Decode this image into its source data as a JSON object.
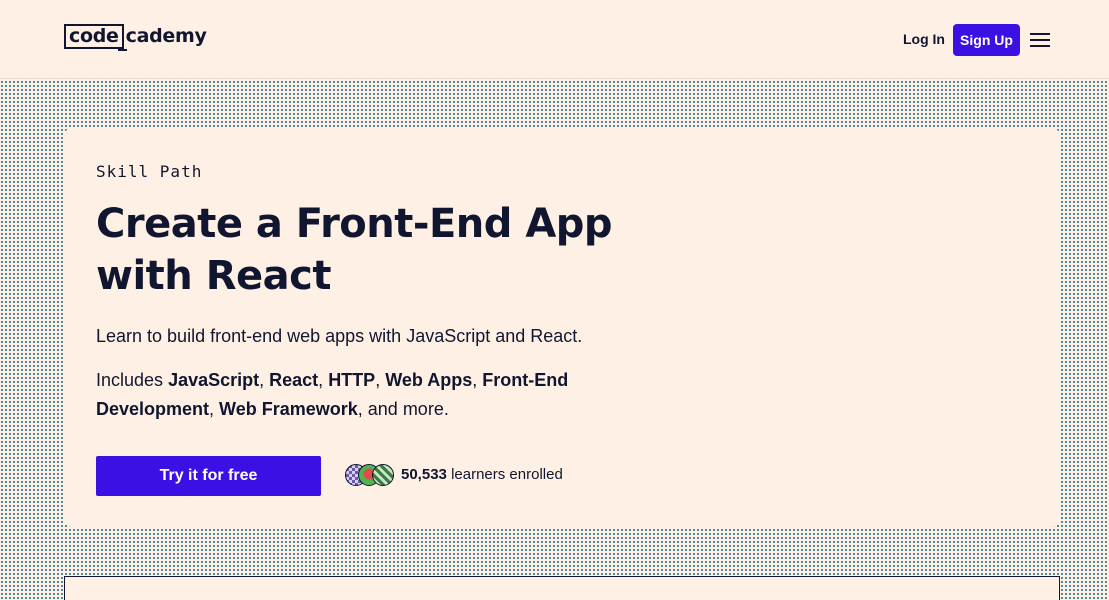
{
  "header": {
    "logo_boxed": "code",
    "logo_rest": "cademy",
    "login_label": "Log In",
    "signup_label": "Sign Up",
    "menu_icon": "hamburger-menu-icon"
  },
  "hero": {
    "eyebrow": "Skill Path",
    "title_line1": "Create a Front-End App",
    "title_line2": "with React",
    "description": "Learn to build front-end web apps with JavaScript and React.",
    "includes_prefix": "Includes",
    "includes_items": [
      "JavaScript",
      "React",
      "HTTP",
      "Web Apps",
      "Front-End Development",
      "Web Framework"
    ],
    "includes_suffix": "and more.",
    "cta_label": "Try it for free",
    "learners_count": "50,533",
    "learners_label": "learners enrolled"
  },
  "colors": {
    "brand_accent": "#3a10e5",
    "background": "#fff0e5",
    "text": "#10162f"
  }
}
